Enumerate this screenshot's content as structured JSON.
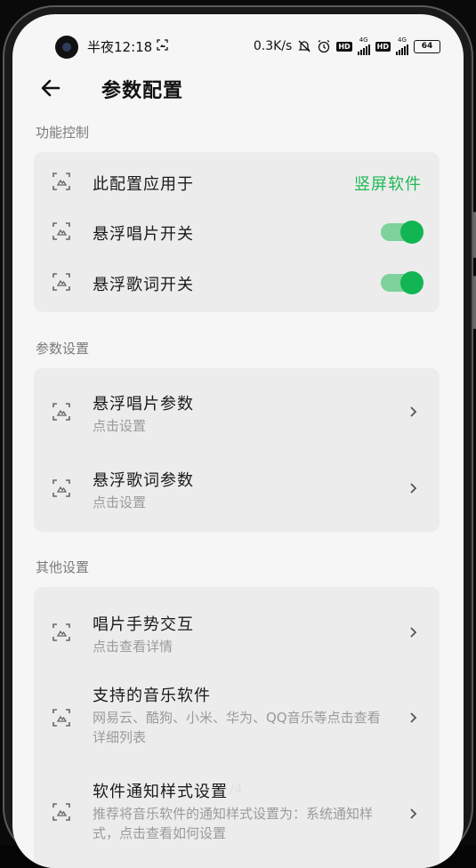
{
  "status_bar": {
    "time": "半夜12:18",
    "net_speed": "0.3K/s",
    "hd1": "HD",
    "net1": "4G",
    "hd2": "HD",
    "net2": "4G",
    "battery": "64"
  },
  "header": {
    "title": "参数配置"
  },
  "sections": {
    "function": {
      "label": "功能控制",
      "apply_to": {
        "title": "此配置应用于",
        "value": "竖屏软件"
      },
      "float_disc": {
        "title": "悬浮唱片开关",
        "on": true
      },
      "float_lyrics": {
        "title": "悬浮歌词开关",
        "on": true
      }
    },
    "params": {
      "label": "参数设置",
      "disc_params": {
        "title": "悬浮唱片参数",
        "subtitle": "点击设置"
      },
      "lyrics_params": {
        "title": "悬浮歌词参数",
        "subtitle": "点击设置"
      }
    },
    "other": {
      "label": "其他设置",
      "gesture": {
        "title": "唱片手势交互",
        "subtitle": "点击查看详情"
      },
      "supported": {
        "title": "支持的音乐软件",
        "subtitle": "网易云、酷狗、小米、华为、QQ音乐等点击查看详细列表"
      },
      "notify": {
        "title": "软件通知样式设置",
        "subtitle": "推荐将音乐软件的通知样式设置为：系统通知样式，点击查看如何设置"
      }
    }
  },
  "watermark": "/4",
  "colors": {
    "accent": "#1db954",
    "toggle_knob": "#12b553",
    "card_bg": "#ececec"
  }
}
